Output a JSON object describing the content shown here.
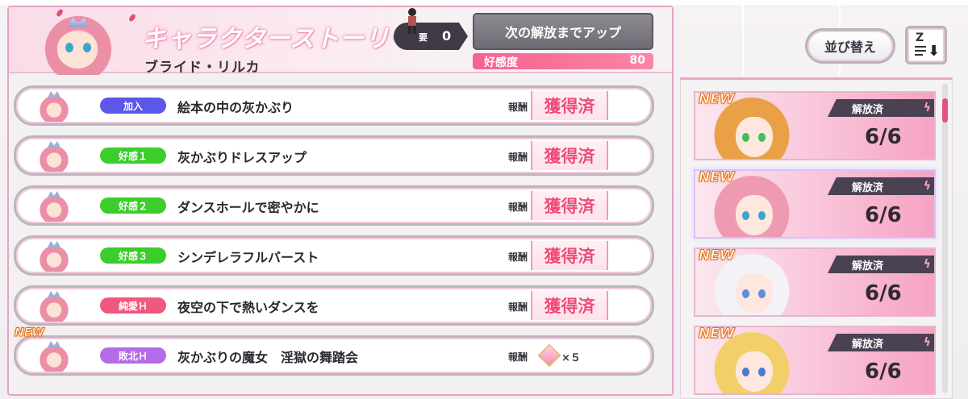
{
  "header": {
    "title": "キャラクターストーリー",
    "character_name": "ブライド・リルカ",
    "requirement": {
      "label": "要",
      "value": "0"
    },
    "next_button_label": "次の解放までアップ",
    "affinity": {
      "label": "好感度",
      "value": "80",
      "fill_fraction": 1.0
    }
  },
  "controls": {
    "sort_label": "並び替え",
    "order_label": "Z"
  },
  "stories": [
    {
      "tag": "加入",
      "tag_color": "#5b57e8",
      "title": "絵本の中の灰かぶり",
      "reward_label": "報酬",
      "reward_status": "獲得済",
      "new": false
    },
    {
      "tag": "好感１",
      "tag_color": "#3ccd2c",
      "title": "灰かぶりドレスアップ",
      "reward_label": "報酬",
      "reward_status": "獲得済",
      "new": false
    },
    {
      "tag": "好感２",
      "tag_color": "#3ccd2c",
      "title": "ダンスホールで密やかに",
      "reward_label": "報酬",
      "reward_status": "獲得済",
      "new": false
    },
    {
      "tag": "好感３",
      "tag_color": "#3ccd2c",
      "title": "シンデレラフルバースト",
      "reward_label": "報酬",
      "reward_status": "獲得済",
      "new": false
    },
    {
      "tag": "純愛Ｈ",
      "tag_color": "#f0587d",
      "title": "夜空の下で熱いダンスを",
      "reward_label": "報酬",
      "reward_status": "獲得済",
      "new": false
    },
    {
      "tag": "敗北Ｈ",
      "tag_color": "#b46be6",
      "title": "灰かぶりの魔女　淫獄の舞踏会",
      "reward_label": "報酬",
      "reward_status": "",
      "reward_count": "×５",
      "new": true
    }
  ],
  "new_badge": "NEW",
  "characters": [
    {
      "status": "解放済",
      "count": "6/6",
      "new": true,
      "hair": "#e9a046",
      "eyes": "#3fbf5a",
      "active": false
    },
    {
      "status": "解放済",
      "count": "6/6",
      "new": true,
      "hair": "#ee9bb1",
      "eyes": "#3aa6c9",
      "active": true
    },
    {
      "status": "解放済",
      "count": "6/6",
      "new": true,
      "hair": "#f2f2f7",
      "eyes": "#5f8be0",
      "active": false
    },
    {
      "status": "解放済",
      "count": "6/6",
      "new": true,
      "hair": "#f3cf6a",
      "eyes": "#4a7bd1",
      "active": false
    }
  ],
  "colors": {
    "accent_pink": "#f7618e",
    "reward_red": "#f04a78",
    "panel_border": "#e3a4c7"
  },
  "scroll": {
    "position_fraction": 0.05
  }
}
